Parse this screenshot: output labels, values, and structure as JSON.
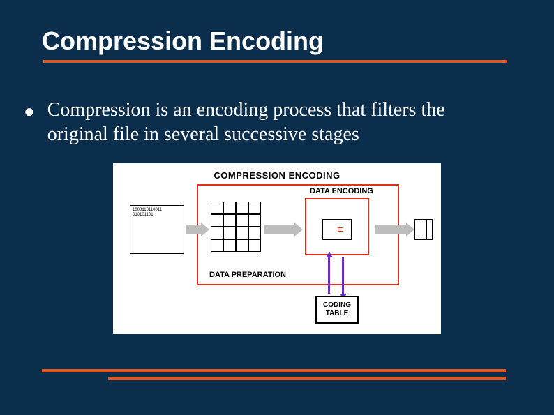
{
  "slide": {
    "title": "Compression Encoding",
    "bullet": "Compression is an encoding process that filters the original file in several successive stages"
  },
  "diagram": {
    "title": "COMPRESSION ENCODING",
    "data_encoding_label": "DATA ENCODING",
    "data_preparation_label": "DATA PREPARATION",
    "coding_table_line1": "CODING",
    "coding_table_line2": "TABLE",
    "input_bits_line1": "1000110110011",
    "input_bits_line2": "010101101..."
  }
}
